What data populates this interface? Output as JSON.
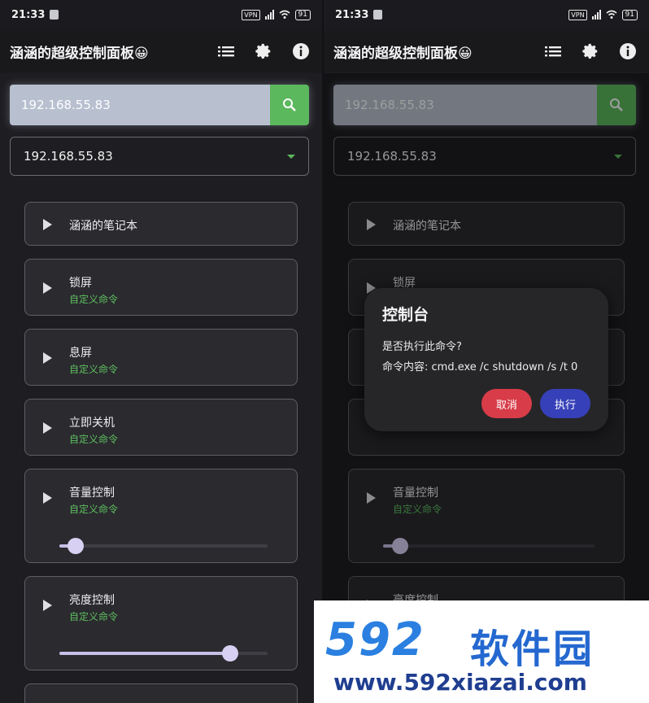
{
  "status": {
    "time": "21:33",
    "vpn": "VPN",
    "battery": "91"
  },
  "app": {
    "title": "涵涵的超级控制面板😀"
  },
  "search": {
    "value": "192.168.55.83"
  },
  "select": {
    "value": "192.168.55.83"
  },
  "cards": {
    "notebook": {
      "title": "涵涵的笔记本"
    },
    "lock": {
      "title": "锁屏",
      "sub": "自定义命令"
    },
    "screen_off": {
      "title": "息屏",
      "sub": "自定义命令"
    },
    "shutdown": {
      "title": "立即关机",
      "sub": "自定义命令"
    },
    "volume": {
      "title": "音量控制",
      "sub": "自定义命令",
      "level": 0.08
    },
    "brightness": {
      "title": "亮度控制",
      "sub": "自定义命令",
      "level": 0.82
    }
  },
  "dialog": {
    "title": "控制台",
    "line1": "是否执行此命令?",
    "line2": "命令内容: cmd.exe /c shutdown /s /t 0",
    "cancel": "取消",
    "run": "执行"
  },
  "watermark": {
    "number": "592",
    "name": "软件园",
    "url": "www.592xiazai.com"
  },
  "colors": {
    "accent_green": "#5cb85c",
    "cancel_red": "#d83c48",
    "run_blue": "#3640b8"
  }
}
